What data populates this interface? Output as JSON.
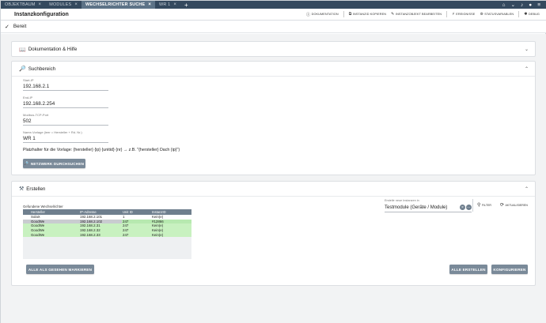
{
  "tabs": [
    {
      "label": "OBJEKTBAUM",
      "active": false
    },
    {
      "label": "MODULES",
      "active": false
    },
    {
      "label": "WECHSELRICHTER SUCHE",
      "active": true
    },
    {
      "label": "WR 1",
      "active": false
    }
  ],
  "tab_add": "+",
  "tab_close": "×",
  "header": {
    "title": "Instanzkonfiguration",
    "tools": [
      {
        "icon": "info-icon",
        "glyph": "ⓘ",
        "label": "DOKUMENTATION"
      },
      {
        "icon": "copy-icon",
        "glyph": "⧉",
        "label": "INSTANZID KOPIEREN"
      },
      {
        "icon": "edit-icon",
        "glyph": "✎",
        "label": "INSTANZOBJEKT BEARBEITEN"
      },
      {
        "icon": "event-icon",
        "glyph": "⚡",
        "label": "EREIGNISSE"
      },
      {
        "icon": "variables-icon",
        "glyph": "⊚",
        "label": "STATUSVARIABLEN"
      },
      {
        "icon": "debug-icon",
        "glyph": "✱",
        "label": "DEBUG"
      }
    ]
  },
  "status": {
    "text": "Bereit"
  },
  "panels": {
    "doc": {
      "title": "Dokumentation & Hilfe"
    },
    "search": {
      "title": "Suchbereich",
      "fields": [
        {
          "label": "Start-IP",
          "value": "192.168.2.1"
        },
        {
          "label": "End-IP",
          "value": "192.168.2.254"
        },
        {
          "label": "Modbus-TCP-Port",
          "value": "502"
        },
        {
          "label": "Name-Vorlage (leer = Hersteller + Rd. Nr.)",
          "value": "WR 1"
        }
      ],
      "placeholder_hint": "Platzhalter für die Vorlage: {hersteller} {ip} {unitid} {nr} → z.B. \"{hersteller} Dach {ip}\")",
      "scan_button": "NETZWERK DURCHSUCHEN"
    },
    "create": {
      "title": "Erstellen",
      "found_label": "Gefundene Wechselrichter",
      "columns": [
        "Hersteller",
        "IP-Adresse",
        "Unit ID",
        "InstanzID"
      ],
      "rows": [
        {
          "maker": "SolaX",
          "ip": "192.168.2.101",
          "unit": "1",
          "inst": "Kein(e)",
          "style": "white"
        },
        {
          "maker": "GoodWe",
          "ip": "192.168.2.102",
          "unit": "247",
          "inst": "#12866",
          "style": "sel"
        },
        {
          "maker": "GoodWe",
          "ip": "192.168.2.31",
          "unit": "247",
          "inst": "Kein(e)",
          "style": "green"
        },
        {
          "maker": "GoodWe",
          "ip": "192.168.2.32",
          "unit": "247",
          "inst": "Kein(e)",
          "style": "green"
        },
        {
          "maker": "GoodWe",
          "ip": "192.168.2.33",
          "unit": "247",
          "inst": "Kein(e)",
          "style": "green"
        }
      ],
      "target_label": "Erstelle neue Instanzen in",
      "target_value": "Testmodule (Geräte / Module)",
      "filter_label": "FILTER",
      "refresh_label": "AKTUALISIEREN",
      "mark_button": "ALLE ALS GESEHEN MARKIEREN",
      "create_all_button": "ALLE ERSTELLEN",
      "configure_button": "KONFIGURIEREN"
    }
  },
  "colors": {
    "tabbar": "#34495e",
    "active_tab": "#5d7387",
    "button": "#7a8a99",
    "row_green": "#c8f1c0",
    "row_selected": "#c9ccd0"
  }
}
